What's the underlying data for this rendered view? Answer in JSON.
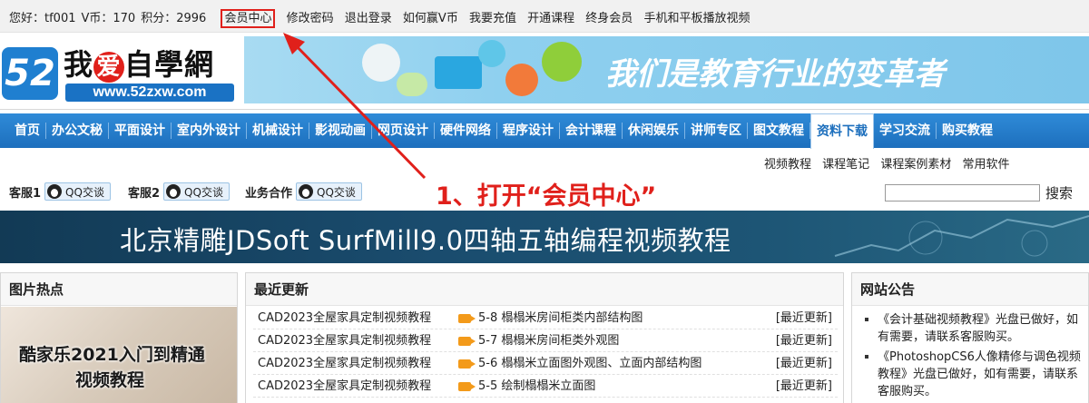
{
  "topbar": {
    "greeting": "您好：tf001",
    "vcoin": "V币：170",
    "points": "积分：2996",
    "links": [
      "会员中心",
      "修改密码",
      "退出登录",
      "如何赢V币",
      "我要充值",
      "开通课程",
      "终身会员",
      "手机和平板播放视频"
    ]
  },
  "logo": {
    "num": "52",
    "name_pre": "我",
    "heart": "爱",
    "name_post": "自學網",
    "url": "www.52zxw.com"
  },
  "banner": {
    "slogan": "我们是教育行业的变革者"
  },
  "nav": {
    "items": [
      "首页",
      "办公文秘",
      "平面设计",
      "室内外设计",
      "机械设计",
      "影视动画",
      "网页设计",
      "硬件网络",
      "程序设计",
      "会计课程",
      "休闲娱乐",
      "讲师专区",
      "图文教程",
      "资料下载",
      "学习交流",
      "购买教程"
    ],
    "active_index": 13
  },
  "subnav": [
    "视频教程",
    "课程笔记",
    "课程案例素材",
    "常用软件"
  ],
  "service": {
    "items": [
      {
        "label": "客服1",
        "qq": "QQ交谈"
      },
      {
        "label": "客服2",
        "qq": "QQ交谈"
      },
      {
        "label": "业务合作",
        "qq": "QQ交谈"
      }
    ],
    "search_value": "",
    "search_button": "搜索"
  },
  "annotation": {
    "text": "1、打开“会员中心”",
    "color": "#e0201b"
  },
  "promo": {
    "title": "北京精雕JDSoft SurfMill9.0四轴五轴编程视频教程"
  },
  "panels": {
    "hot": {
      "title": "图片热点",
      "line1": "酷家乐2021入门到精通",
      "line2": "视频教程"
    },
    "latest": {
      "title": "最近更新",
      "rows": [
        {
          "course": "CAD2023全屋家具定制视频教程",
          "lesson": "5-8 榻榻米房间柜类内部结构图",
          "tag": "[最近更新]"
        },
        {
          "course": "CAD2023全屋家具定制视频教程",
          "lesson": "5-7 榻榻米房间柜类外观图",
          "tag": "[最近更新]"
        },
        {
          "course": "CAD2023全屋家具定制视频教程",
          "lesson": "5-6 榻榻米立面图外观图、立面内部结构图",
          "tag": "[最近更新]"
        },
        {
          "course": "CAD2023全屋家具定制视频教程",
          "lesson": "5-5 绘制榻榻米立面图",
          "tag": "[最近更新]"
        }
      ]
    },
    "notice": {
      "title": "网站公告",
      "items": [
        "《会计基础视频教程》光盘已做好，如有需要，请联系客服购买。",
        "《PhotoshopCS6人像精修与调色视频教程》光盘已做好，如有需要，请联系客服购买。"
      ]
    }
  },
  "colors": {
    "nav": "#1d6fbd",
    "accent": "#e0201b",
    "promo": "#1a4c6e"
  }
}
